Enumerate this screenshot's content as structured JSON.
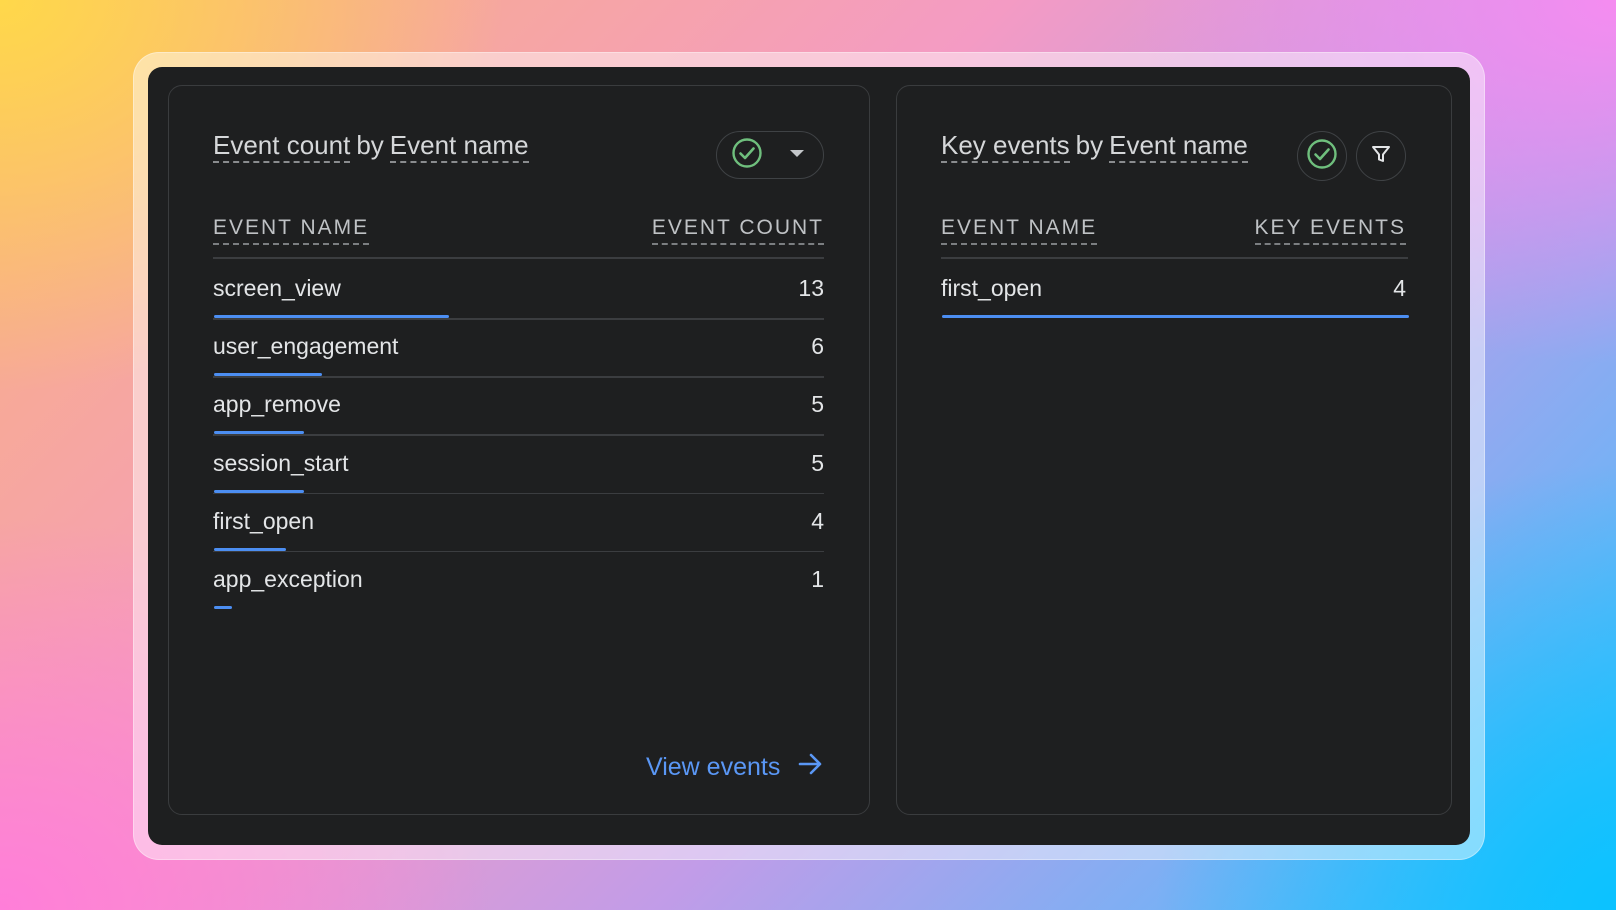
{
  "left_card": {
    "title_metric": "Event count",
    "title_by": "by",
    "title_dimension": "Event name",
    "col_name": "EVENT NAME",
    "col_value": "EVENT COUNT",
    "rows": [
      {
        "name": "screen_view",
        "value": "13",
        "fraction": 1.0
      },
      {
        "name": "user_engagement",
        "value": "6",
        "fraction": 0.4615
      },
      {
        "name": "app_remove",
        "value": "5",
        "fraction": 0.3846
      },
      {
        "name": "session_start",
        "value": "5",
        "fraction": 0.3846
      },
      {
        "name": "first_open",
        "value": "4",
        "fraction": 0.3077
      },
      {
        "name": "app_exception",
        "value": "1",
        "fraction": 0.0769
      }
    ],
    "link_label": "View events"
  },
  "right_card": {
    "title_metric": "Key events",
    "title_by": "by",
    "title_dimension": "Event name",
    "col_name": "EVENT NAME",
    "col_value": "KEY EVENTS",
    "rows": [
      {
        "name": "first_open",
        "value": "4",
        "fraction": 1.0
      }
    ]
  },
  "icons": {
    "status": "check-circle-icon",
    "dropdown": "caret-down-icon",
    "filter": "filter-icon",
    "link_arrow": "arrow-right-icon"
  },
  "colors": {
    "bar": "#4c8ef2",
    "check": "#6fbf7d",
    "link": "#5a97f5"
  }
}
